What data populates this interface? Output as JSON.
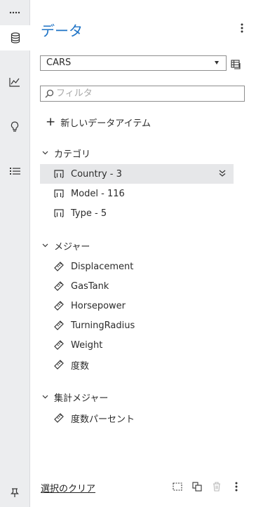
{
  "rail": {
    "items": [
      {
        "icon": "more-horizontal-icon"
      },
      {
        "icon": "database-icon"
      },
      {
        "icon": "line-chart-icon"
      },
      {
        "icon": "lightbulb-icon"
      },
      {
        "icon": "list-icon"
      },
      {
        "icon": "pin-icon"
      }
    ]
  },
  "panel": {
    "title": "データ",
    "data_source": "CARS",
    "filter_placeholder": "フィルタ",
    "new_item_label": "新しいデータアイテム"
  },
  "groups": [
    {
      "label": "カテゴリ",
      "items": [
        {
          "label": "Country - 3",
          "icon": "category-icon",
          "selected": true
        },
        {
          "label": "Model - 116",
          "icon": "category-icon"
        },
        {
          "label": "Type - 5",
          "icon": "category-icon"
        }
      ]
    },
    {
      "label": "メジャー",
      "items": [
        {
          "label": "Displacement",
          "icon": "measure-icon"
        },
        {
          "label": "GasTank",
          "icon": "measure-icon"
        },
        {
          "label": "Horsepower",
          "icon": "measure-icon"
        },
        {
          "label": "TurningRadius",
          "icon": "measure-icon"
        },
        {
          "label": "Weight",
          "icon": "measure-icon"
        },
        {
          "label": "度数",
          "icon": "measure-icon"
        }
      ]
    },
    {
      "label": "集計メジャー",
      "items": [
        {
          "label": "度数パーセント",
          "icon": "measure-icon"
        }
      ]
    }
  ],
  "footer": {
    "clear_selection_label": "選択のクリア"
  },
  "colors": {
    "accent": "#1e73c6",
    "rail_bg": "#ecedef",
    "selected_row": "#e6e7e9"
  }
}
